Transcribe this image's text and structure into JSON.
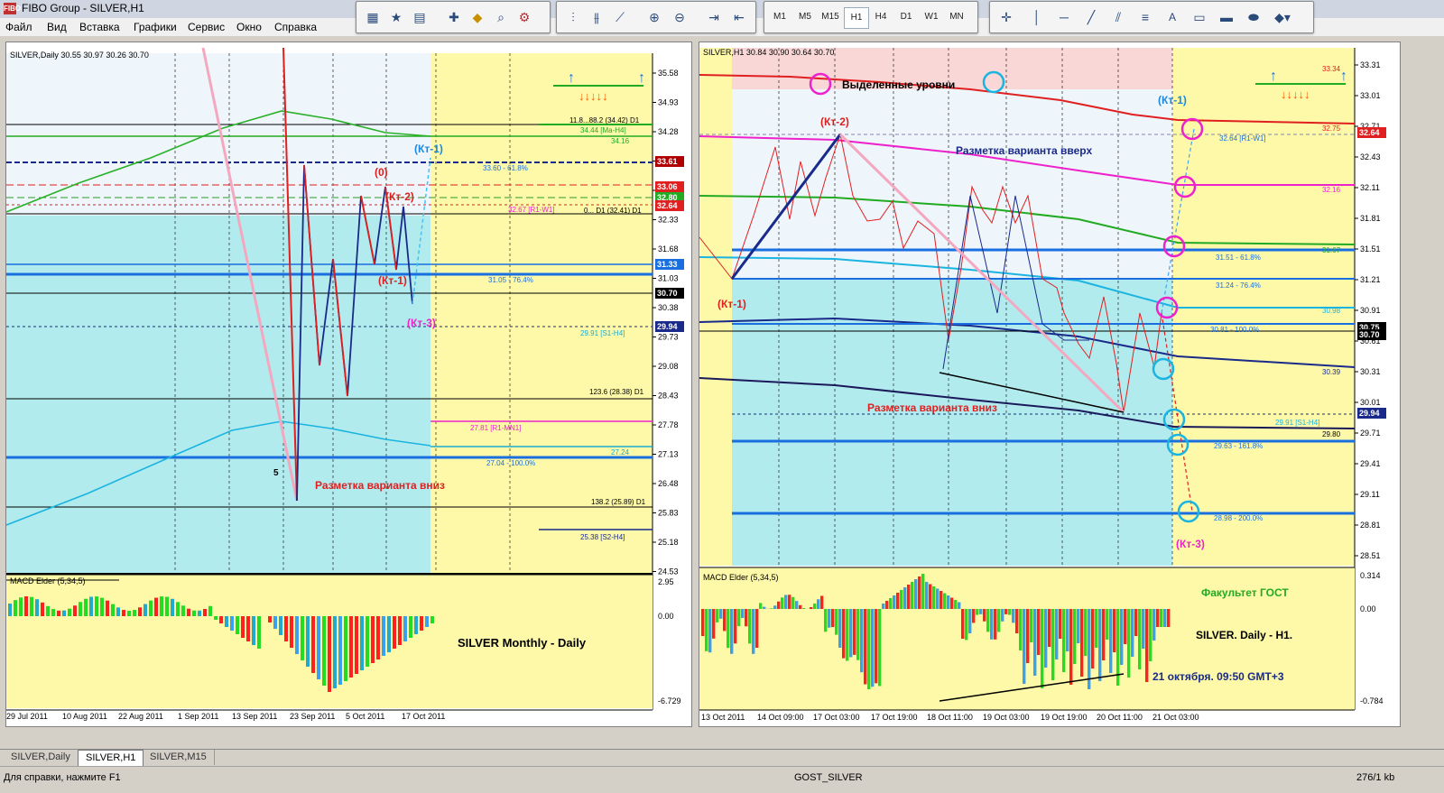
{
  "window": {
    "title": "FIBO Group - SILVER,H1",
    "logo": "FIBO"
  },
  "menu": [
    "Файл",
    "Вид",
    "Вставка",
    "Графики",
    "Сервис",
    "Окно",
    "Справка"
  ],
  "timeframes": [
    "M1",
    "M5",
    "M15",
    "H1",
    "H4",
    "D1",
    "W1",
    "MN"
  ],
  "active_timeframe": "H1",
  "left_chart": {
    "header": "SILVER,Daily  30.55 30.97 30.26 30.70",
    "price_ticks": [
      "35.58",
      "34.93",
      "34.28",
      "33.61",
      "32.96",
      "32.33",
      "31.68",
      "31.03",
      "30.38",
      "29.73",
      "29.08",
      "28.43",
      "27.78",
      "27.13",
      "26.48",
      "25.83",
      "25.18",
      "24.53"
    ],
    "date_ticks": [
      "29 Jul 2011",
      "10 Aug 2011",
      "22 Aug 2011",
      "1 Sep 2011",
      "13 Sep 2011",
      "23 Sep 2011",
      "5 Oct 2011",
      "17 Oct 2011"
    ],
    "price_tags": [
      "33.61",
      "33.06",
      "32.80",
      "32.64",
      "31.33",
      "30.70",
      "29.94"
    ],
    "levels": {
      "l1": "11.8...88.2 (34.42) D1",
      "l2": "34.44 [Ma-H4]",
      "l3": "34.16",
      "l4": "33.60 - 61.8%",
      "l5": "32.67 [R1-W1]",
      "l6": "0... D1 (32.41) D1",
      "l7": "31.05 - 76.4%",
      "l8": "29.91 [S1-H4]",
      "l9": "123.6 (28.38) D1",
      "l10": "27.81 [R1-MN1]",
      "l11": "27.24",
      "l12": "27.04 - 100.0%",
      "l13": "138.2 (25.89) D1",
      "l14": "25.38 [S2-H4]"
    },
    "labels": {
      "kt1_blue": "(Кт-1)",
      "zero": "(0)",
      "kt2": "(Кт-2)",
      "kt1_red": "(Кт-1)",
      "kt3": "(Кт-3)",
      "five": "5",
      "down_variant": "Разметка варианта вниз"
    },
    "macd": {
      "header": "MACD Elder (5,34,5)",
      "ticks": [
        "2.95",
        "0.00",
        "-6.729"
      ],
      "caption": "SILVER  Monthly - Daily"
    }
  },
  "right_chart": {
    "header": "SILVER,H1  30.84 30.90 30.64 30.70",
    "price_ticks": [
      "33.31",
      "33.01",
      "32.71",
      "32.43",
      "32.11",
      "31.81",
      "31.51",
      "31.21",
      "30.91",
      "30.61",
      "30.31",
      "30.01",
      "29.71",
      "29.41",
      "29.11",
      "28.81",
      "28.51"
    ],
    "date_ticks": [
      "13 Oct 2011",
      "14 Oct 09:00",
      "17 Oct 03:00",
      "17 Oct 19:00",
      "18 Oct 11:00",
      "19 Oct 03:00",
      "19 Oct 19:00",
      "20 Oct 11:00",
      "21 Oct 03:00"
    ],
    "price_tags": [
      "32.64",
      "30.75",
      "30.70",
      "29.94"
    ],
    "levels": {
      "r1": "33.34",
      "r2": "32.75",
      "r3": "32.64 [R1-W1]",
      "r4": "32.16",
      "r5": "31.67",
      "r6": "31.51 - 61.8%",
      "r7": "31.24 - 76.4%",
      "r8": "30.98",
      "r9": "30.81 - 100.0%",
      "r10": "30.39",
      "r11": "29.91 [S1-H4]",
      "r12": "29.80",
      "r13": "29.63 - 161.8%",
      "r14": "28.98 - 200.0%"
    },
    "labels": {
      "highlighted": "Выделенные уровни",
      "kt2": "(Кт-2)",
      "up_variant": "Разметка варианта вверх",
      "kt1_red": "(Кт-1)",
      "kt1_blue": "(Кт-1)",
      "down_variant": "Разметка варианта вниз",
      "kt3": "(Кт-3)"
    },
    "macd": {
      "header": "MACD Elder (5,34,5)",
      "ticks": [
        "0.314",
        "0.00",
        "-0.784"
      ],
      "faculty": "Факультет ГОСТ",
      "caption": "SILVER. Daily - H1.",
      "date": "21 октября. 09:50 GMT+3"
    }
  },
  "tabs": [
    "SILVER,Daily",
    "SILVER,H1",
    "SILVER,M15"
  ],
  "active_tab": "SILVER,H1",
  "status": {
    "help": "Для справки, нажмите F1",
    "profile": "GOST_SILVER",
    "traffic": "276/1 kb"
  }
}
